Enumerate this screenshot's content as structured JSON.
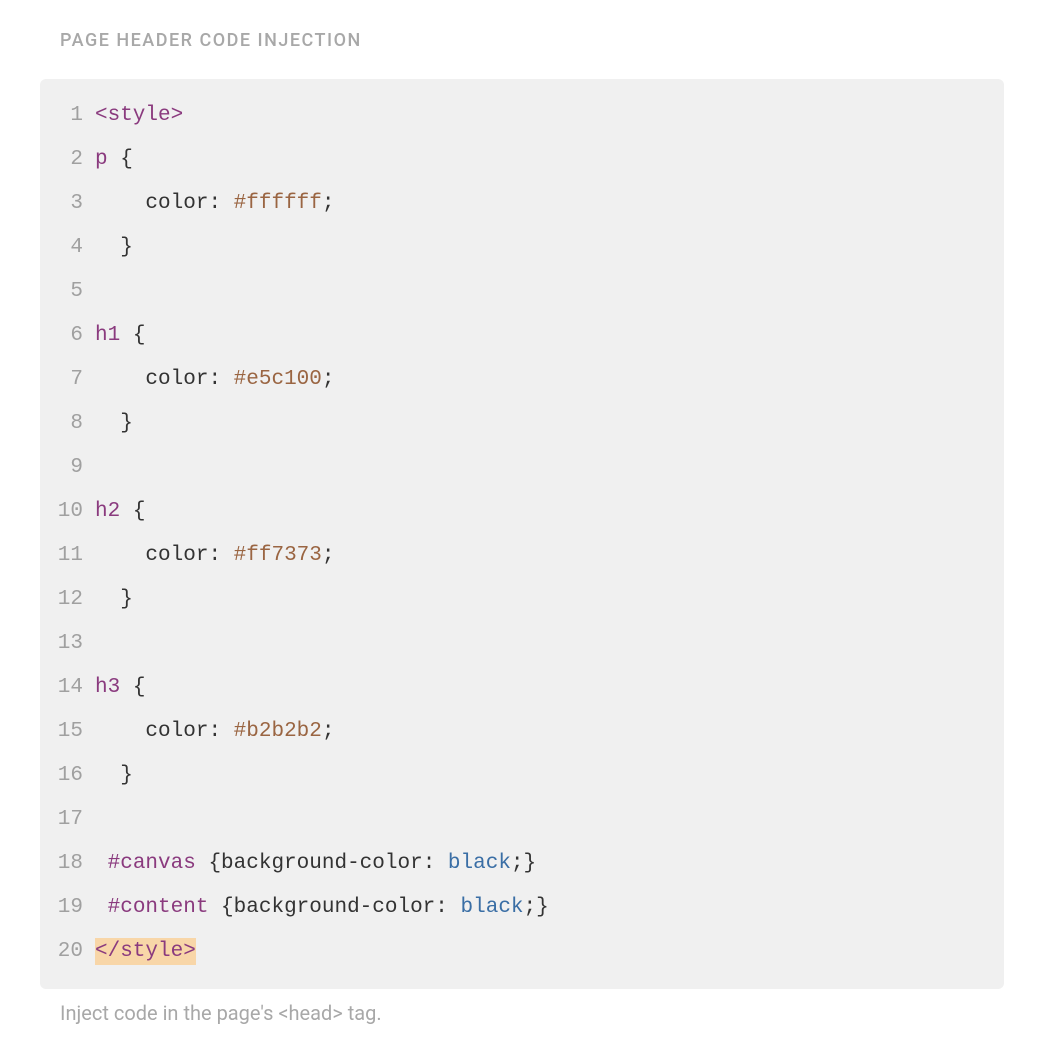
{
  "section": {
    "label": "PAGE HEADER CODE INJECTION",
    "help": "Inject code in the page's <head> tag."
  },
  "code": {
    "lines": [
      {
        "num": "1",
        "tokens": [
          {
            "t": "<style>",
            "c": "tag"
          }
        ]
      },
      {
        "num": "2",
        "tokens": [
          {
            "t": "p",
            "c": "selector"
          },
          {
            "t": " ",
            "c": "plain"
          },
          {
            "t": "{",
            "c": "brace"
          }
        ]
      },
      {
        "num": "3",
        "tokens": [
          {
            "t": "    ",
            "c": "plain"
          },
          {
            "t": "color",
            "c": "prop"
          },
          {
            "t": ": ",
            "c": "punct"
          },
          {
            "t": "#ffffff",
            "c": "hex"
          },
          {
            "t": ";",
            "c": "punct"
          }
        ]
      },
      {
        "num": "4",
        "tokens": [
          {
            "t": "  ",
            "c": "plain"
          },
          {
            "t": "}",
            "c": "brace"
          }
        ]
      },
      {
        "num": "5",
        "tokens": []
      },
      {
        "num": "6",
        "tokens": [
          {
            "t": "h1",
            "c": "selector"
          },
          {
            "t": " ",
            "c": "plain"
          },
          {
            "t": "{",
            "c": "brace"
          }
        ]
      },
      {
        "num": "7",
        "tokens": [
          {
            "t": "    ",
            "c": "plain"
          },
          {
            "t": "color",
            "c": "prop"
          },
          {
            "t": ": ",
            "c": "punct"
          },
          {
            "t": "#e5c100",
            "c": "hex"
          },
          {
            "t": ";",
            "c": "punct"
          }
        ]
      },
      {
        "num": "8",
        "tokens": [
          {
            "t": "  ",
            "c": "plain"
          },
          {
            "t": "}",
            "c": "brace"
          }
        ]
      },
      {
        "num": "9",
        "tokens": []
      },
      {
        "num": "10",
        "tokens": [
          {
            "t": "h2",
            "c": "selector"
          },
          {
            "t": " ",
            "c": "plain"
          },
          {
            "t": "{",
            "c": "brace"
          }
        ]
      },
      {
        "num": "11",
        "tokens": [
          {
            "t": "    ",
            "c": "plain"
          },
          {
            "t": "color",
            "c": "prop"
          },
          {
            "t": ": ",
            "c": "punct"
          },
          {
            "t": "#ff7373",
            "c": "hex"
          },
          {
            "t": ";",
            "c": "punct"
          }
        ]
      },
      {
        "num": "12",
        "tokens": [
          {
            "t": "  ",
            "c": "plain"
          },
          {
            "t": "}",
            "c": "brace"
          }
        ]
      },
      {
        "num": "13",
        "tokens": []
      },
      {
        "num": "14",
        "tokens": [
          {
            "t": "h3",
            "c": "selector"
          },
          {
            "t": " ",
            "c": "plain"
          },
          {
            "t": "{",
            "c": "brace"
          }
        ]
      },
      {
        "num": "15",
        "tokens": [
          {
            "t": "    ",
            "c": "plain"
          },
          {
            "t": "color",
            "c": "prop"
          },
          {
            "t": ": ",
            "c": "punct"
          },
          {
            "t": "#b2b2b2",
            "c": "hex"
          },
          {
            "t": ";",
            "c": "punct"
          }
        ]
      },
      {
        "num": "16",
        "tokens": [
          {
            "t": "  ",
            "c": "plain"
          },
          {
            "t": "}",
            "c": "brace"
          }
        ]
      },
      {
        "num": "17",
        "tokens": []
      },
      {
        "num": "18",
        "tokens": [
          {
            "t": " ",
            "c": "plain"
          },
          {
            "t": "#canvas",
            "c": "selector"
          },
          {
            "t": " ",
            "c": "plain"
          },
          {
            "t": "{",
            "c": "brace"
          },
          {
            "t": "background-color",
            "c": "prop"
          },
          {
            "t": ": ",
            "c": "punct"
          },
          {
            "t": "black",
            "c": "named"
          },
          {
            "t": ";",
            "c": "punct"
          },
          {
            "t": "}",
            "c": "brace"
          }
        ]
      },
      {
        "num": "19",
        "tokens": [
          {
            "t": " ",
            "c": "plain"
          },
          {
            "t": "#content",
            "c": "selector"
          },
          {
            "t": " ",
            "c": "plain"
          },
          {
            "t": "{",
            "c": "brace"
          },
          {
            "t": "background-color",
            "c": "prop"
          },
          {
            "t": ": ",
            "c": "punct"
          },
          {
            "t": "black",
            "c": "named"
          },
          {
            "t": ";",
            "c": "punct"
          },
          {
            "t": "}",
            "c": "brace"
          }
        ]
      },
      {
        "num": "20",
        "tokens": [
          {
            "t": "</style>",
            "c": "tag",
            "hl": true
          }
        ]
      }
    ]
  }
}
